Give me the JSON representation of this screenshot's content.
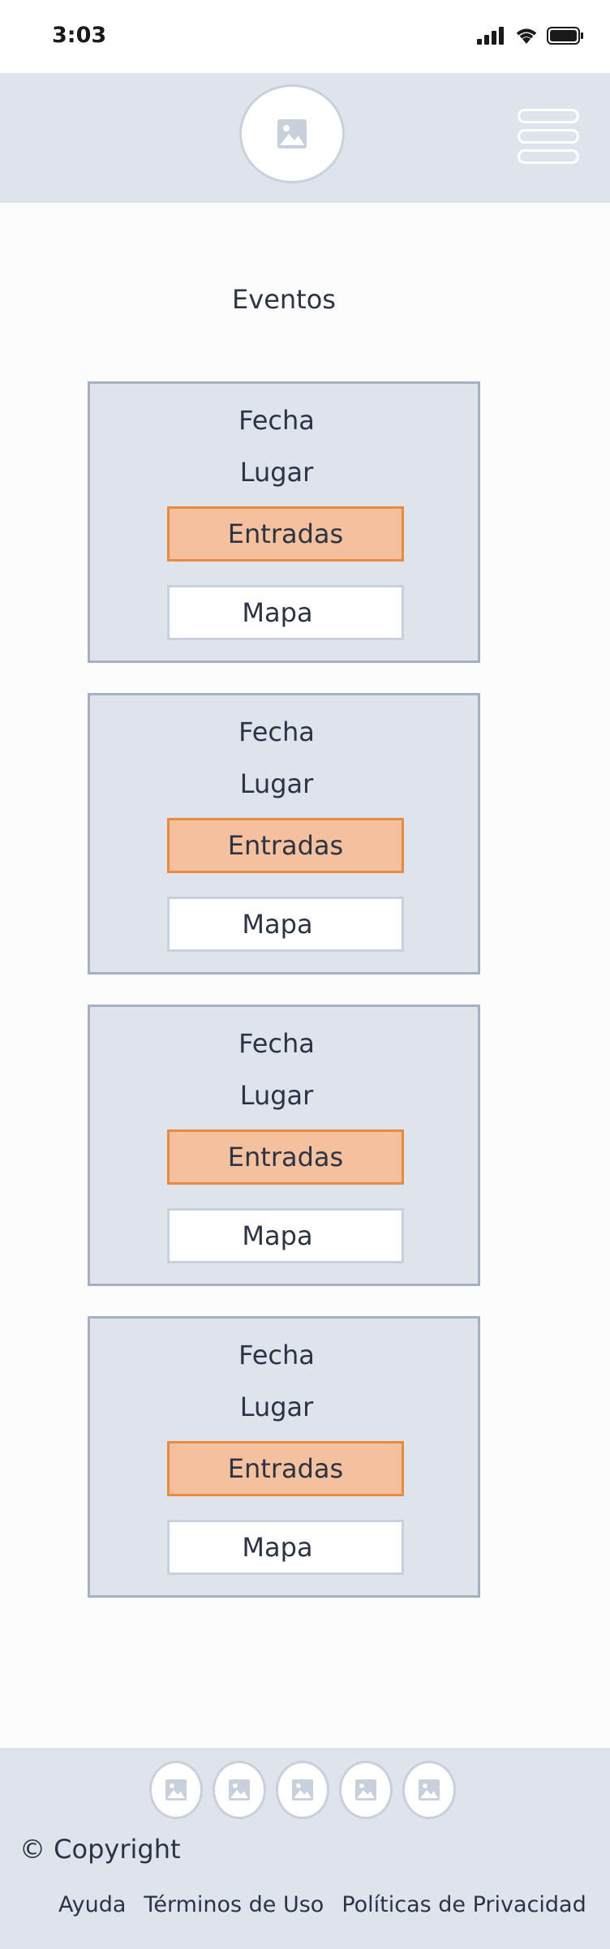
{
  "status_bar": {
    "time": "3:03"
  },
  "header": {
    "logo_icon": "image-placeholder-icon",
    "menu_icon": "hamburger-menu-icon"
  },
  "main": {
    "title": "Eventos",
    "events": [
      {
        "fecha": "Fecha",
        "lugar": "Lugar",
        "entradas_label": "Entradas",
        "mapa_label": "Mapa"
      },
      {
        "fecha": "Fecha",
        "lugar": "Lugar",
        "entradas_label": "Entradas",
        "mapa_label": "Mapa"
      },
      {
        "fecha": "Fecha",
        "lugar": "Lugar",
        "entradas_label": "Entradas",
        "mapa_label": "Mapa"
      },
      {
        "fecha": "Fecha",
        "lugar": "Lugar",
        "entradas_label": "Entradas",
        "mapa_label": "Mapa"
      }
    ]
  },
  "footer": {
    "social_icons": [
      "image-placeholder-icon",
      "image-placeholder-icon",
      "image-placeholder-icon",
      "image-placeholder-icon",
      "image-placeholder-icon"
    ],
    "copyright": "© Copyright",
    "links": [
      "Ayuda",
      "Términos de Uso",
      "Políticas de Privacidad"
    ]
  },
  "colors": {
    "header_bg": "#dfe4ec",
    "card_border": "#a4b1c0",
    "accent_fill": "#f4c09d",
    "accent_border": "#ea8a3f",
    "text": "#2b3445"
  }
}
